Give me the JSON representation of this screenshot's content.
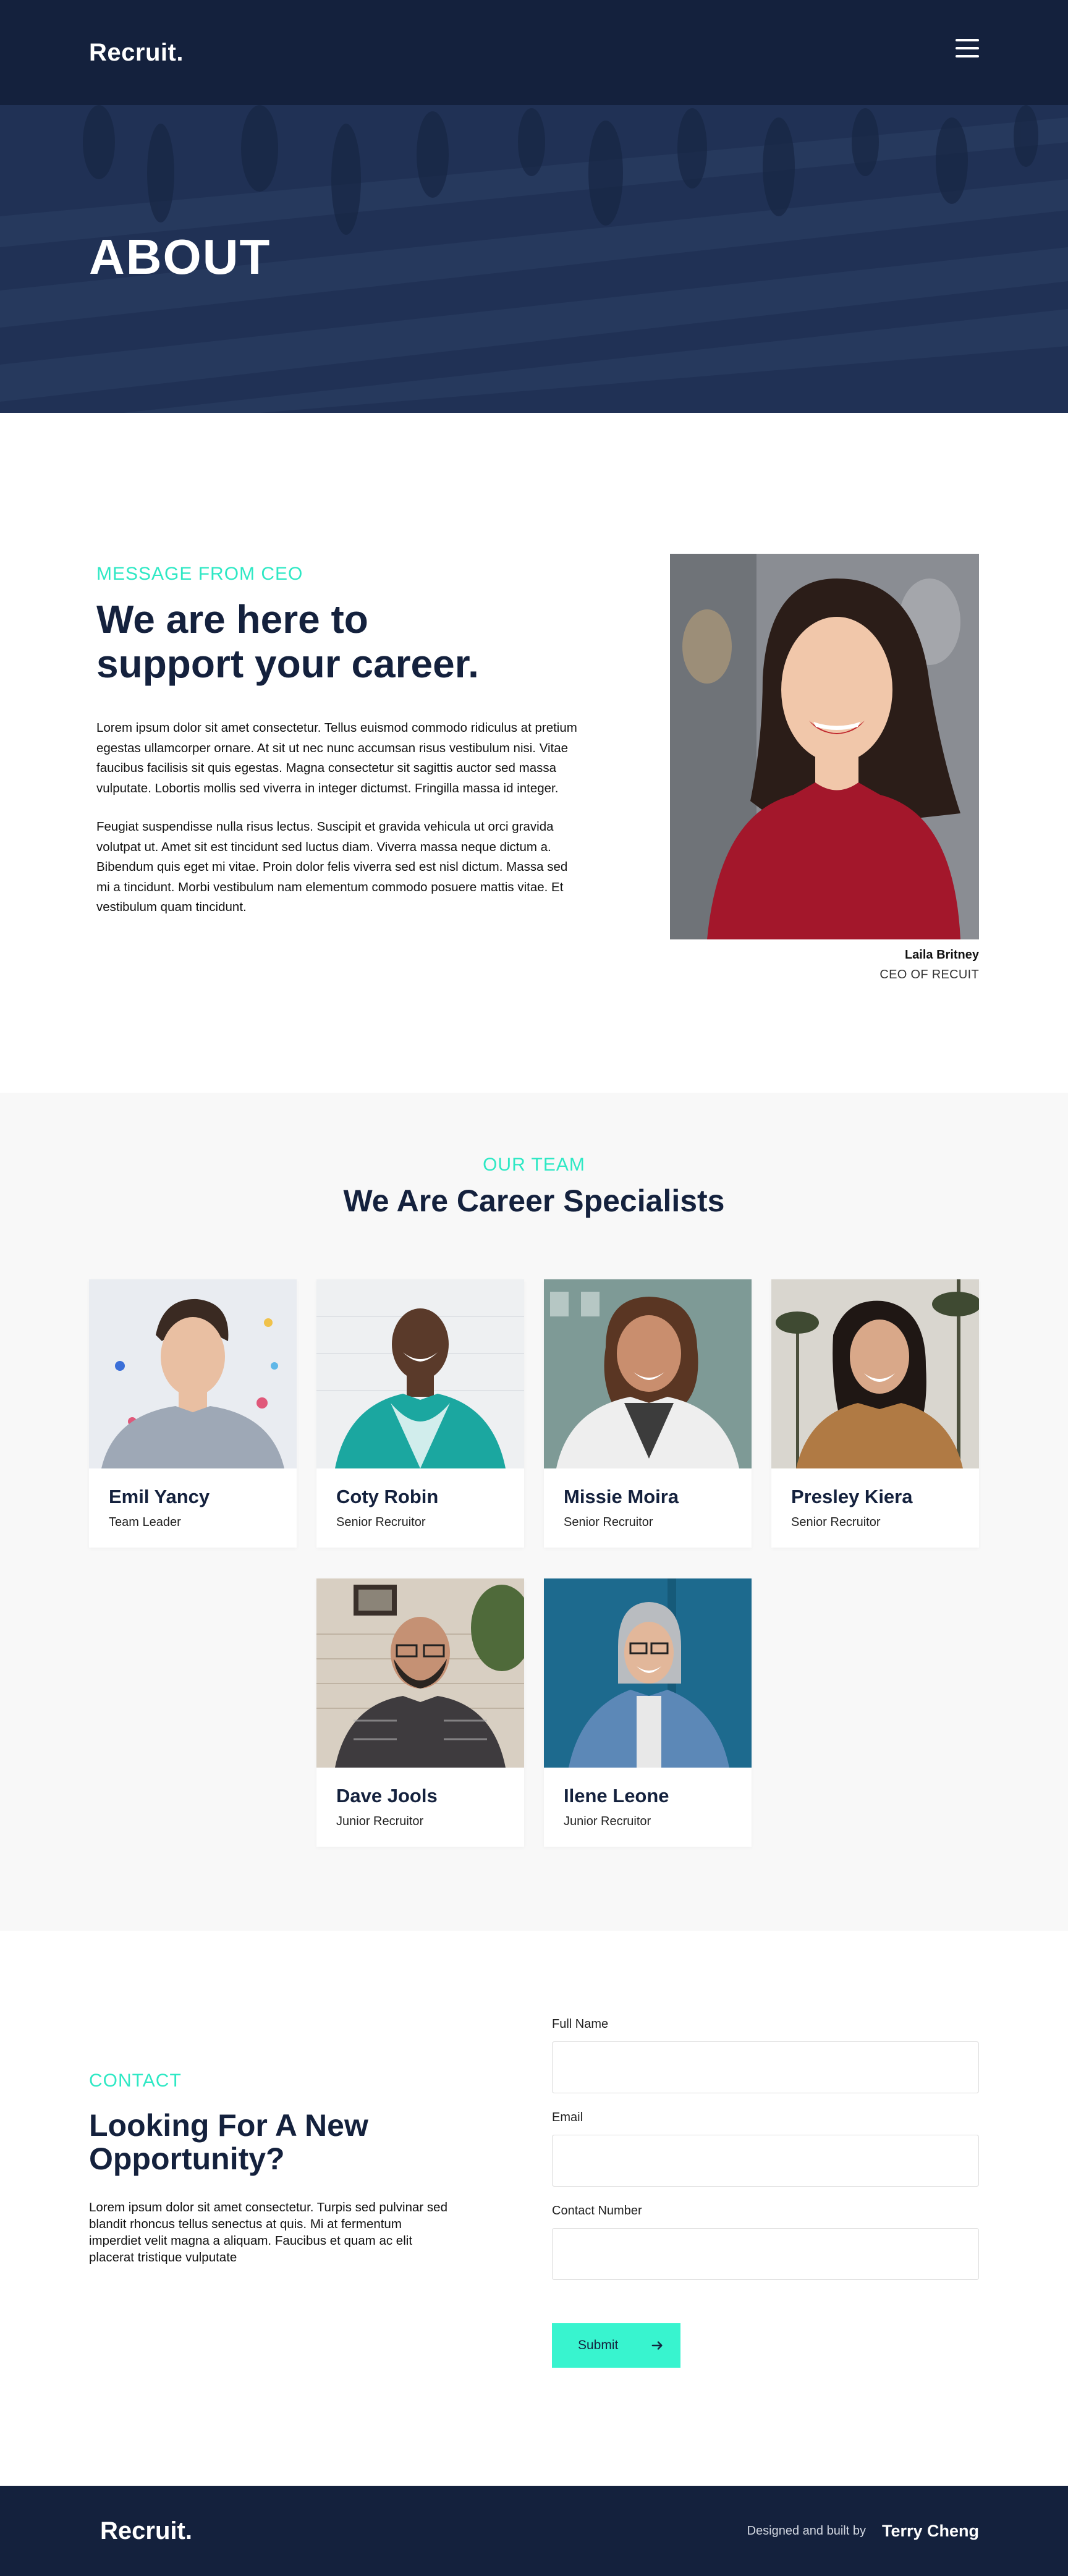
{
  "nav": {
    "logo": "Recruit.",
    "menu_icon": "hamburger-menu-icon"
  },
  "hero": {
    "title": "ABOUT"
  },
  "ceo": {
    "eyebrow": "MESSAGE FROM CEO",
    "heading_line1": "We are here to",
    "heading_line2": "support your career.",
    "paragraph1": "Lorem ipsum dolor sit amet consectetur. Tellus euismod commodo ridiculus at pretium egestas ullamcorper ornare. At sit ut nec nunc accumsan risus vestibulum nisi. Vitae faucibus facilisis sit quis egestas. Magna consectetur sit sagittis auctor sed massa vulputate. Lobortis mollis sed viverra in integer dictumst. Fringilla massa id integer.",
    "paragraph2": "Feugiat suspendisse nulla risus lectus. Suscipit et gravida vehicula ut orci gravida volutpat ut. Amet sit est tincidunt sed luctus diam. Viverra massa neque dictum a. Bibendum quis eget mi vitae. Proin dolor felis viverra sed est nisl dictum. Massa sed mi a tincidunt. Morbi vestibulum nam elementum commodo posuere mattis vitae. Et vestibulum quam tincidunt.",
    "name": "Laila Britney",
    "role": "CEO OF RECUIT"
  },
  "team": {
    "eyebrow": "OUR TEAM",
    "heading": "We Are Career Specialists",
    "members": [
      {
        "name": "Emil Yancy",
        "role": "Team Leader"
      },
      {
        "name": "Coty Robin",
        "role": "Senior Recruitor"
      },
      {
        "name": "Missie Moira",
        "role": "Senior Recruitor"
      },
      {
        "name": "Presley Kiera",
        "role": "Senior Recruitor"
      },
      {
        "name": "Dave Jools",
        "role": "Junior Recruitor"
      },
      {
        "name": "Ilene Leone",
        "role": "Junior Recruitor"
      }
    ]
  },
  "contact": {
    "eyebrow": "CONTACT",
    "heading_line1": "Looking For A New",
    "heading_line2": "Opportunity?",
    "paragraph": "Lorem ipsum dolor sit amet consectetur. Turpis sed pulvinar sed blandit rhoncus tellus senectus at quis. Mi at fermentum imperdiet velit magna a aliquam. Faucibus et quam ac elit placerat tristique vulputate",
    "form": {
      "full_name_label": "Full Name",
      "full_name_value": "",
      "email_label": "Email",
      "email_value": "",
      "phone_label": "Contact Number",
      "phone_value": "",
      "submit_label": "Submit",
      "submit_icon": "arrow-right-icon"
    }
  },
  "footer": {
    "logo": "Recruit.",
    "credit": "Designed and built by",
    "author": "Terry Cheng"
  },
  "colors": {
    "navy": "#14213d",
    "accent": "#2ee8c4",
    "button": "#38f4cf",
    "section_gray": "#f8f8f8"
  }
}
